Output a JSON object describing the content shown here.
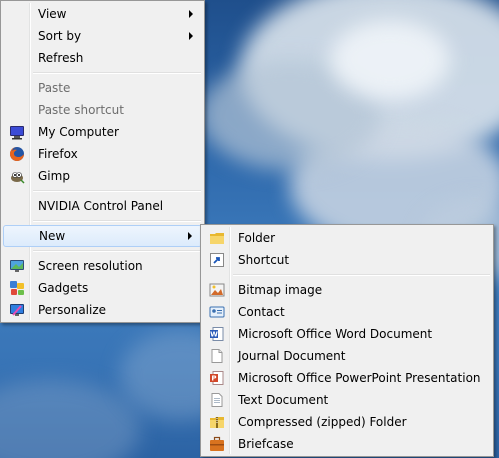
{
  "desktop": {
    "background": "blue sky with clouds"
  },
  "context_menu": {
    "items": [
      {
        "label": "View",
        "submenu": true
      },
      {
        "label": "Sort by",
        "submenu": true
      },
      {
        "label": "Refresh"
      },
      {
        "label": "Paste",
        "disabled": true
      },
      {
        "label": "Paste shortcut",
        "disabled": true
      },
      {
        "label": "My Computer",
        "icon": "my-computer-icon"
      },
      {
        "label": "Firefox",
        "icon": "firefox-icon"
      },
      {
        "label": "Gimp",
        "icon": "gimp-icon"
      },
      {
        "label": "NVIDIA Control Panel"
      },
      {
        "label": "New",
        "submenu": true,
        "highlighted": true
      },
      {
        "label": "Screen resolution",
        "icon": "screen-resolution-icon"
      },
      {
        "label": "Gadgets",
        "icon": "gadgets-icon"
      },
      {
        "label": "Personalize",
        "icon": "personalize-icon"
      }
    ]
  },
  "new_submenu": {
    "items": [
      {
        "label": "Folder",
        "icon": "folder-icon"
      },
      {
        "label": "Shortcut",
        "icon": "shortcut-icon"
      },
      {
        "label": "Bitmap image",
        "icon": "bitmap-icon"
      },
      {
        "label": "Contact",
        "icon": "contact-icon"
      },
      {
        "label": "Microsoft Office Word Document",
        "icon": "word-document-icon"
      },
      {
        "label": "Journal Document",
        "icon": "journal-document-icon"
      },
      {
        "label": "Microsoft Office PowerPoint Presentation",
        "icon": "powerpoint-icon"
      },
      {
        "label": "Text Document",
        "icon": "text-document-icon"
      },
      {
        "label": "Compressed (zipped) Folder",
        "icon": "zip-folder-icon"
      },
      {
        "label": "Briefcase",
        "icon": "briefcase-icon"
      }
    ]
  },
  "colors": {
    "menu_bg": "#f0f0f0",
    "highlight_border": "#aecff7",
    "disabled_text": "#6d6d6d"
  }
}
